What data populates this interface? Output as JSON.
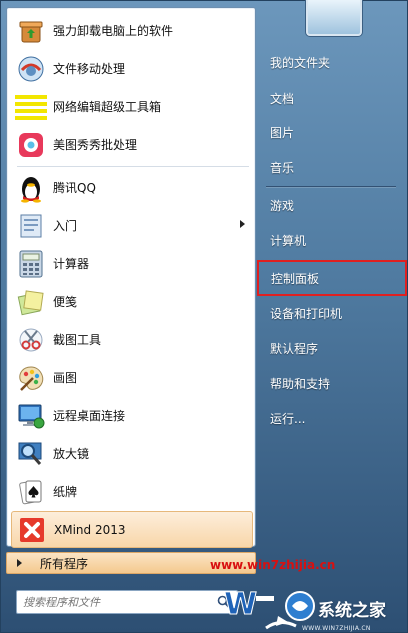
{
  "left_programs": [
    {
      "label": "强力卸载电脑上的软件",
      "icon": "uninstall-box-icon"
    },
    {
      "label": "文件移动处理",
      "icon": "file-move-icon"
    },
    {
      "label": "网络编辑超级工具箱",
      "icon": "toolbox-icon"
    },
    {
      "label": "美图秀秀批处理",
      "icon": "meitu-icon"
    }
  ],
  "pinned_programs": [
    {
      "label": "腾讯QQ",
      "icon": "qq-penguin-icon"
    },
    {
      "label": "入门",
      "icon": "getting-started-icon",
      "has_submenu": true
    },
    {
      "label": "计算器",
      "icon": "calculator-icon"
    },
    {
      "label": "便笺",
      "icon": "sticky-notes-icon"
    },
    {
      "label": "截图工具",
      "icon": "snipping-tool-icon"
    },
    {
      "label": "画图",
      "icon": "paint-palette-icon"
    },
    {
      "label": "远程桌面连接",
      "icon": "remote-desktop-icon"
    },
    {
      "label": "放大镜",
      "icon": "magnifier-icon"
    },
    {
      "label": "纸牌",
      "icon": "solitaire-card-icon"
    },
    {
      "label": "XMind 2013",
      "icon": "xmind-icon",
      "highlighted": true
    }
  ],
  "all_programs_label": "所有程序",
  "search": {
    "placeholder": "搜索程序和文件"
  },
  "right_items": [
    {
      "label": "我的文件夹"
    },
    {
      "label": "文档"
    },
    {
      "label": "图片"
    },
    {
      "label": "音乐"
    },
    {
      "label": "游戏"
    },
    {
      "label": "计算机"
    },
    {
      "label": "控制面板",
      "boxed": true
    },
    {
      "label": "设备和打印机"
    },
    {
      "label": "默认程序"
    },
    {
      "label": "帮助和支持"
    },
    {
      "label": "运行..."
    }
  ],
  "watermark": {
    "url": "www.win7zhijia.cn",
    "site_name": "系统之家",
    "sub": "WWW.WIN7ZHIJIA.CN"
  },
  "colors": {
    "highlight_box": "#e02020",
    "watermark_url": "#d81010"
  }
}
